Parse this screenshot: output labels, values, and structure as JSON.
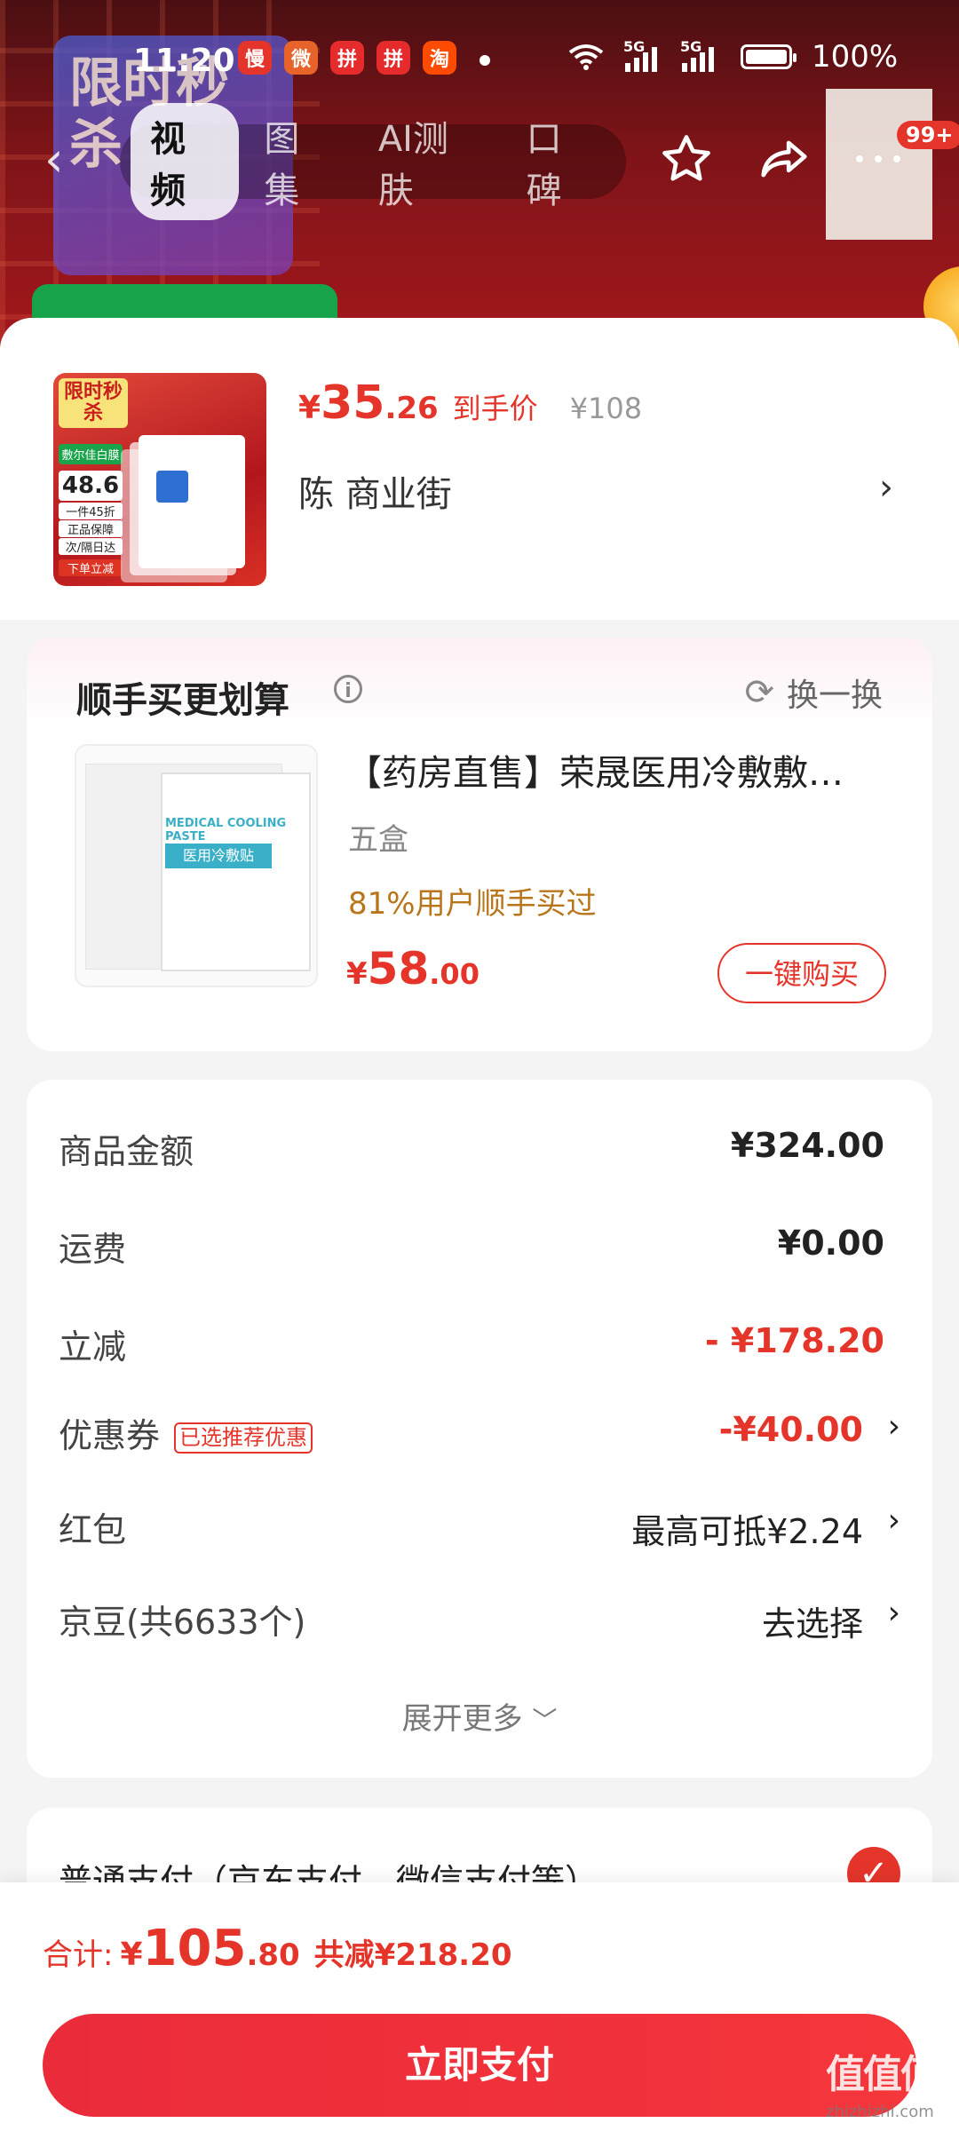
{
  "status_bar": {
    "time": "11:20",
    "app_badges": [
      {
        "icon": "慢",
        "color": "#e5352b"
      },
      {
        "icon": "微",
        "color": "#e8632a"
      },
      {
        "icon": "拼",
        "color": "#e52b2b"
      },
      {
        "icon": "拼",
        "color": "#e52b2b"
      },
      {
        "icon": "淘",
        "color": "#ff4b00"
      }
    ],
    "network_1": "5G",
    "network_2": "5G",
    "battery": "100%"
  },
  "nav": {
    "tabs": [
      "视频",
      "图集",
      "AI测肤",
      "口碑"
    ],
    "active_tab": 0,
    "badge": "99+"
  },
  "background": {
    "promo_text": "限时秒杀"
  },
  "sheet_header": {
    "price_symbol": "¥",
    "price_int": "35",
    "price_dec": ".26",
    "price_label": "到手价",
    "original_price": "¥108",
    "address": "陈  商业街",
    "thumb": {
      "stamp": "限时秒杀",
      "brand": "敷尔佳白膜",
      "price": "48.6",
      "line1": "一件45折",
      "line2": "正品保障",
      "line3": "次/隔日达",
      "line4": "下单立减"
    }
  },
  "bundle": {
    "title": "顺手买更划算",
    "swap_label": "换一换",
    "product_name": "【药房直售】荣晟医用冷敷敷…",
    "spec": "五盒",
    "percent_text": "81%用户顺手买过",
    "price_symbol": "¥",
    "price_int": "58",
    "price_dec": ".00",
    "buy_label": "一键购买",
    "img_label": "医用冷敷贴",
    "img_label_en": "MEDICAL COOLING PASTE"
  },
  "breakdown": {
    "rows": [
      {
        "label": "商品金额",
        "value": "¥324.00"
      },
      {
        "label": "运费",
        "value": "¥0.00"
      },
      {
        "label": "立减",
        "value": "- ¥178.20"
      },
      {
        "label": "优惠券",
        "tag": "已选推荐优惠",
        "value": "-¥40.00"
      },
      {
        "label": "红包",
        "value": "最高可抵¥2.24"
      },
      {
        "label": "京豆(共6633个)",
        "value": "去选择"
      }
    ],
    "expand_label": "展开更多"
  },
  "payment": {
    "label": "普通支付（京东支付、微信支付等）"
  },
  "bottom": {
    "total_label": "合计:",
    "total_symbol": "¥",
    "total_int": "105",
    "total_dec": ".80",
    "saved": "共减¥218.20",
    "pay_label": "立即支付"
  },
  "watermark": {
    "text": "值值值",
    "sub": "zhizhizhi.com"
  }
}
